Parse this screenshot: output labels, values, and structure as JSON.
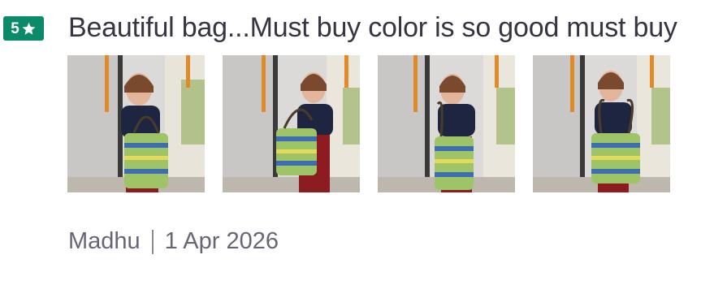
{
  "review": {
    "rating": "5",
    "rating_icon": "star-icon",
    "title": "Beautiful bag...Must buy color is so good must buy",
    "photos": [
      {
        "alt": "review-photo-1"
      },
      {
        "alt": "review-photo-2"
      },
      {
        "alt": "review-photo-3"
      },
      {
        "alt": "review-photo-4"
      }
    ],
    "reviewer": "Madhu",
    "date": "1 Apr 2026"
  },
  "colors": {
    "badge": "#0b8a6a",
    "title": "#353543",
    "meta": "#666677"
  }
}
